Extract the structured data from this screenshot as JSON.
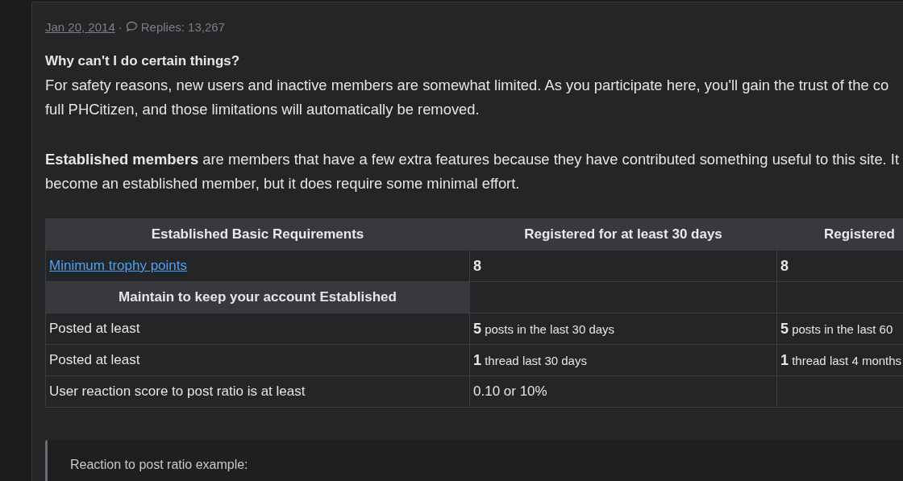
{
  "post_meta": {
    "date": "Jan 20, 2014",
    "separator": "·",
    "replies": "Replies: 13,267"
  },
  "heading": "Why can't I do certain things?",
  "paragraphs": [
    {
      "lines": [
        "For safety reasons, new users and inactive members are somewhat limited. As you participate here, you'll gain the trust of the co",
        "full PHCitizen, and those limitations will automatically be removed."
      ]
    },
    {
      "lines": [
        "**Established members** are members that have a few extra features because they have contributed something useful to this site. It",
        "become an established member, but it does require some minimal effort."
      ]
    }
  ],
  "table": {
    "columns": [
      "Established Basic Requirements",
      "Registered for at least 30 days",
      "Registered"
    ],
    "rows": [
      {
        "kind": "data",
        "cells": [
          {
            "kind": "link",
            "text": "Minimum trophy points"
          },
          {
            "kind": "bold",
            "text": "8"
          },
          {
            "kind": "bold",
            "text": "8"
          }
        ]
      },
      {
        "kind": "section",
        "cells": [
          {
            "kind": "plain",
            "text": "Maintain to keep your account Established"
          },
          {
            "kind": "empty"
          },
          {
            "kind": "empty"
          }
        ]
      },
      {
        "kind": "data",
        "cells": [
          {
            "kind": "plain",
            "text": "Posted at least"
          },
          {
            "kind": "count",
            "text": "**5** posts in the last 30 days"
          },
          {
            "kind": "count",
            "text": "**5** posts in the last 60"
          }
        ]
      },
      {
        "kind": "data",
        "cells": [
          {
            "kind": "plain",
            "text": "Posted at least"
          },
          {
            "kind": "count",
            "text": "**1** thread last 30 days"
          },
          {
            "kind": "count",
            "text": "**1** thread last 4 months"
          }
        ]
      },
      {
        "kind": "data",
        "cells": [
          {
            "kind": "plain",
            "text": "User reaction score to post ratio is at least"
          },
          {
            "kind": "plain",
            "text": "0.10 or 10%"
          },
          {
            "kind": "empty"
          }
        ]
      }
    ]
  },
  "quote": {
    "text": "Reaction to post ratio example:"
  }
}
